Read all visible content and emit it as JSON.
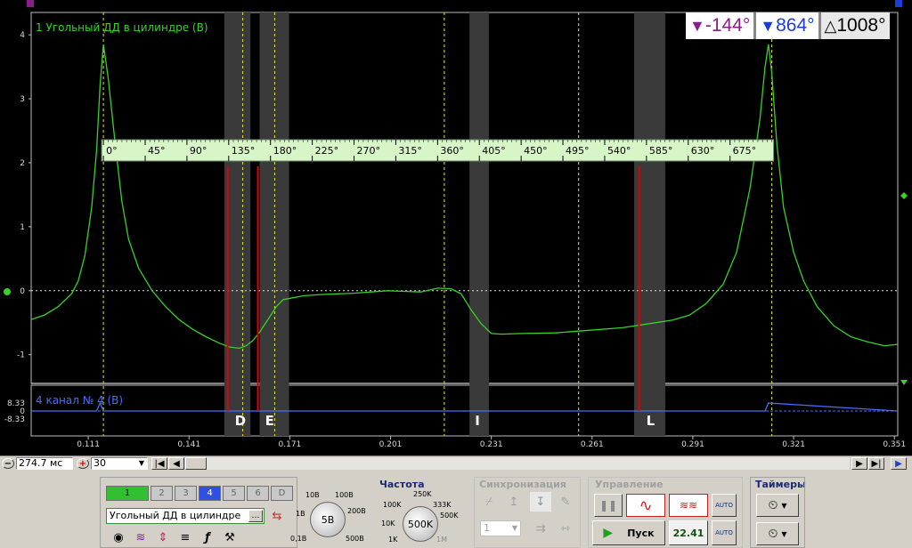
{
  "chart_data": {
    "type": "line",
    "title": "1  Угольный ДД в цилиндре (В)",
    "series": [
      {
        "name": "1  Угольный ДД в цилиндре (В)",
        "color": "#39d02a",
        "x": [
          0.094,
          0.098,
          0.102,
          0.106,
          0.108,
          0.11,
          0.112,
          0.1135,
          0.1145,
          0.1155,
          0.117,
          0.119,
          0.121,
          0.123,
          0.126,
          0.13,
          0.134,
          0.138,
          0.142,
          0.146,
          0.15,
          0.153,
          0.156,
          0.158,
          0.16,
          0.162,
          0.1645,
          0.167,
          0.169,
          0.172,
          0.175,
          0.18,
          0.19,
          0.2,
          0.205,
          0.21,
          0.215,
          0.219,
          0.222,
          0.225,
          0.228,
          0.231,
          0.234,
          0.24,
          0.25,
          0.26,
          0.27,
          0.28,
          0.285,
          0.29,
          0.295,
          0.3,
          0.304,
          0.308,
          0.311,
          0.3125,
          0.3135,
          0.3145,
          0.316,
          0.318,
          0.321,
          0.324,
          0.328,
          0.333,
          0.338,
          0.343,
          0.348,
          0.352
        ],
        "y": [
          -0.45,
          -0.38,
          -0.25,
          -0.05,
          0.15,
          0.55,
          1.3,
          2.2,
          3.2,
          3.85,
          3.3,
          2.3,
          1.4,
          0.8,
          0.35,
          0.0,
          -0.25,
          -0.45,
          -0.6,
          -0.72,
          -0.82,
          -0.88,
          -0.9,
          -0.86,
          -0.78,
          -0.65,
          -0.45,
          -0.25,
          -0.14,
          -0.11,
          -0.08,
          -0.06,
          -0.04,
          0.0,
          -0.01,
          -0.02,
          0.04,
          0.03,
          -0.05,
          -0.3,
          -0.52,
          -0.67,
          -0.68,
          -0.67,
          -0.66,
          -0.62,
          -0.58,
          -0.5,
          -0.46,
          -0.38,
          -0.2,
          0.1,
          0.6,
          1.6,
          2.7,
          3.5,
          3.85,
          3.4,
          2.3,
          1.3,
          0.6,
          0.15,
          -0.25,
          -0.55,
          -0.72,
          -0.8,
          -0.86,
          -0.84
        ]
      },
      {
        "name": "4  канал № 4 (В)",
        "color": "#4a6cff",
        "x": [
          0.094,
          0.1135,
          0.1145,
          0.1155,
          0.3115,
          0.3125,
          0.3135,
          0.352
        ],
        "y": [
          0,
          0,
          8.33,
          0,
          0,
          0,
          8.33,
          0
        ]
      }
    ],
    "xlim": [
      0.094,
      0.352
    ],
    "ylim": [
      -1.45,
      4.35
    ],
    "x_ticks": [
      0.111,
      0.141,
      0.171,
      0.201,
      0.231,
      0.261,
      0.291,
      0.321,
      0.351
    ],
    "y_ticks": [
      4,
      3,
      2,
      1,
      0,
      -1
    ],
    "ch4_ticks": [
      "8.33",
      "0",
      "-8.33"
    ],
    "cursors_x": [
      0.1155,
      0.157,
      0.1665,
      0.217,
      0.257,
      0.3145
    ],
    "shaded_bands": [
      [
        0.1515,
        0.1545
      ],
      [
        0.162,
        0.166
      ],
      [
        0.2245,
        0.2255
      ],
      [
        0.2735,
        0.278
      ]
    ],
    "markers": [
      {
        "label": "D",
        "x": 0.1525
      },
      {
        "label": "E",
        "x": 0.1615
      },
      {
        "label": "I",
        "x": 0.224
      },
      {
        "label": "L",
        "x": 0.275
      }
    ],
    "red_lines": [
      0.1525,
      0.1615,
      0.275
    ],
    "angle_ruler": {
      "x_start": 0.1155,
      "x_end": 0.3145,
      "labels": [
        "0°",
        "45°",
        "90°",
        "135°",
        "180°",
        "225°",
        "270°",
        "315°",
        "360°",
        "405°",
        "450°",
        "495°",
        "540°",
        "585°",
        "630°",
        "675°"
      ]
    },
    "grid": true,
    "legend": "none"
  },
  "angle_readout": {
    "a": "-144°",
    "b": "864°",
    "delta": "1008°",
    "a_icon": "filter-cursor-icon",
    "b_icon": "filter-cursor-icon",
    "delta_icon": "delta-icon"
  },
  "ch1_label": "1  Угольный ДД в цилиндре (В)",
  "ch4_label": "4  канал № 4 (В)",
  "timebase": "274.7 мс",
  "zoom": "30",
  "channels": {
    "buttons": [
      "1",
      "2",
      "3",
      "4",
      "5",
      "6",
      "D"
    ],
    "active": "1",
    "selected": "4",
    "selected_name": "Угольный ДД в цилиндре"
  },
  "voltage": {
    "value": "5В",
    "labels": [
      "10В",
      "100В",
      "1В",
      "200В",
      "0,1В",
      "500В"
    ]
  },
  "frequency": {
    "title": "Частота",
    "value": "500K",
    "labels": [
      "250K",
      "100K",
      "333K",
      "10K",
      "500K",
      "1K",
      "1M"
    ]
  },
  "sync": {
    "title": "Синхронизация",
    "channel": "1"
  },
  "control": {
    "title": "Управление",
    "start_label": "Пуск",
    "counter": "22.41"
  },
  "timers": {
    "title": "Таймеры"
  },
  "colors": {
    "scope_bg": "#000000",
    "signal": "#39d02a",
    "channel4": "#4a6cff",
    "cursor": "#e6e63c",
    "marker_line": "#e00000",
    "ruler_bg": "#d8f5c8",
    "band": "#3a3a3a",
    "active_channel": "#30c030",
    "selected_channel": "#3050e0"
  }
}
